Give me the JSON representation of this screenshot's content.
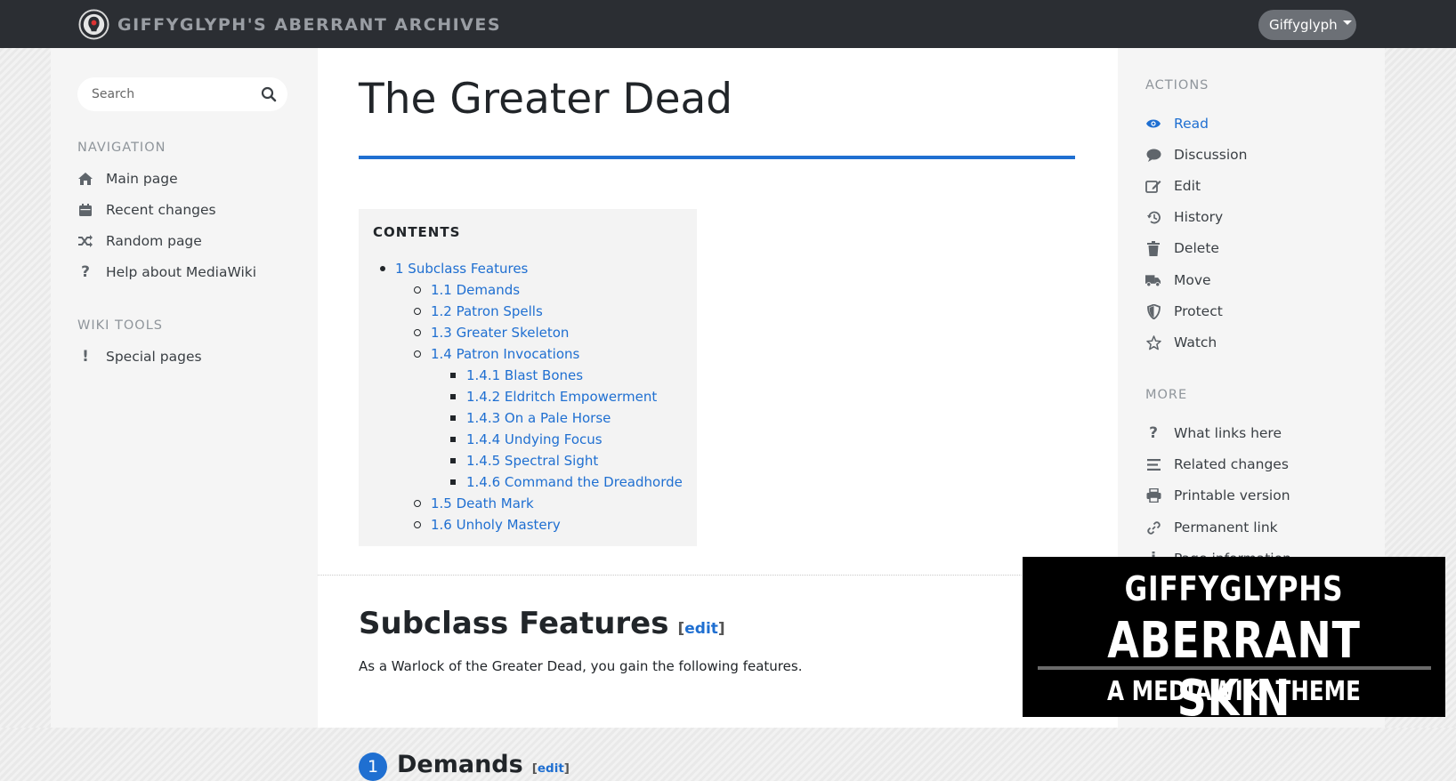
{
  "header": {
    "site_title": "GIFFYGLYPH'S ABERRANT ARCHIVES",
    "user_menu_label": "Giffyglyph"
  },
  "sidebar_left": {
    "search_placeholder": "Search",
    "navigation_heading": "NAVIGATION",
    "navigation_items": [
      {
        "label": "Main page",
        "icon": "home-icon"
      },
      {
        "label": "Recent changes",
        "icon": "calendar-icon"
      },
      {
        "label": "Random page",
        "icon": "shuffle-icon"
      },
      {
        "label": "Help about MediaWiki",
        "icon": "question-icon"
      }
    ],
    "tools_heading": "WIKI TOOLS",
    "tools_items": [
      {
        "label": "Special pages",
        "icon": "exclamation-icon"
      }
    ]
  },
  "main": {
    "page_title": "The Greater Dead",
    "toc": {
      "title": "CONTENTS",
      "items": [
        {
          "label": "1 Subclass Features"
        },
        {
          "label": "1.1 Demands"
        },
        {
          "label": "1.2 Patron Spells"
        },
        {
          "label": "1.3 Greater Skeleton"
        },
        {
          "label": "1.4 Patron Invocations"
        },
        {
          "label": "1.4.1 Blast Bones"
        },
        {
          "label": "1.4.2 Eldritch Empowerment"
        },
        {
          "label": "1.4.3 On a Pale Horse"
        },
        {
          "label": "1.4.4 Undying Focus"
        },
        {
          "label": "1.4.5 Spectral Sight"
        },
        {
          "label": "1.4.6 Command the Dreadhorde"
        },
        {
          "label": "1.5 Death Mark"
        },
        {
          "label": "1.6 Unholy Mastery"
        }
      ]
    },
    "section_heading": "Subclass Features",
    "edit_label": "edit",
    "bracket_open": "[",
    "bracket_close": "]",
    "section_text": "As a Warlock of the Greater Dead, you gain the following features.",
    "subsection_number": "1",
    "subsection_heading": "Demands"
  },
  "sidebar_right": {
    "actions_heading": "ACTIONS",
    "actions": [
      {
        "label": "Read",
        "icon": "eye-icon"
      },
      {
        "label": "Discussion",
        "icon": "comment-icon"
      },
      {
        "label": "Edit",
        "icon": "edit-icon"
      },
      {
        "label": "History",
        "icon": "history-icon"
      },
      {
        "label": "Delete",
        "icon": "trash-icon"
      },
      {
        "label": "Move",
        "icon": "truck-icon"
      },
      {
        "label": "Protect",
        "icon": "shield-icon"
      },
      {
        "label": "Watch",
        "icon": "star-icon"
      }
    ],
    "more_heading": "MORE",
    "more_items": [
      {
        "label": "What links here",
        "icon": "question-icon"
      },
      {
        "label": "Related changes",
        "icon": "list-icon"
      },
      {
        "label": "Printable version",
        "icon": "printer-icon"
      },
      {
        "label": "Permanent link",
        "icon": "link-icon"
      },
      {
        "label": "Page information",
        "icon": "info-icon"
      }
    ]
  },
  "banner": {
    "line1": "GIFFYGLYPHS",
    "line2": "ABERRANT SKIN",
    "line3": "A MEDIAWIKI THEME"
  },
  "colors": {
    "accent": "#1f6fd1",
    "topbar": "#2b2e33",
    "sidebar": "#f5f5f5",
    "toc_bg": "#f3f3f3"
  }
}
